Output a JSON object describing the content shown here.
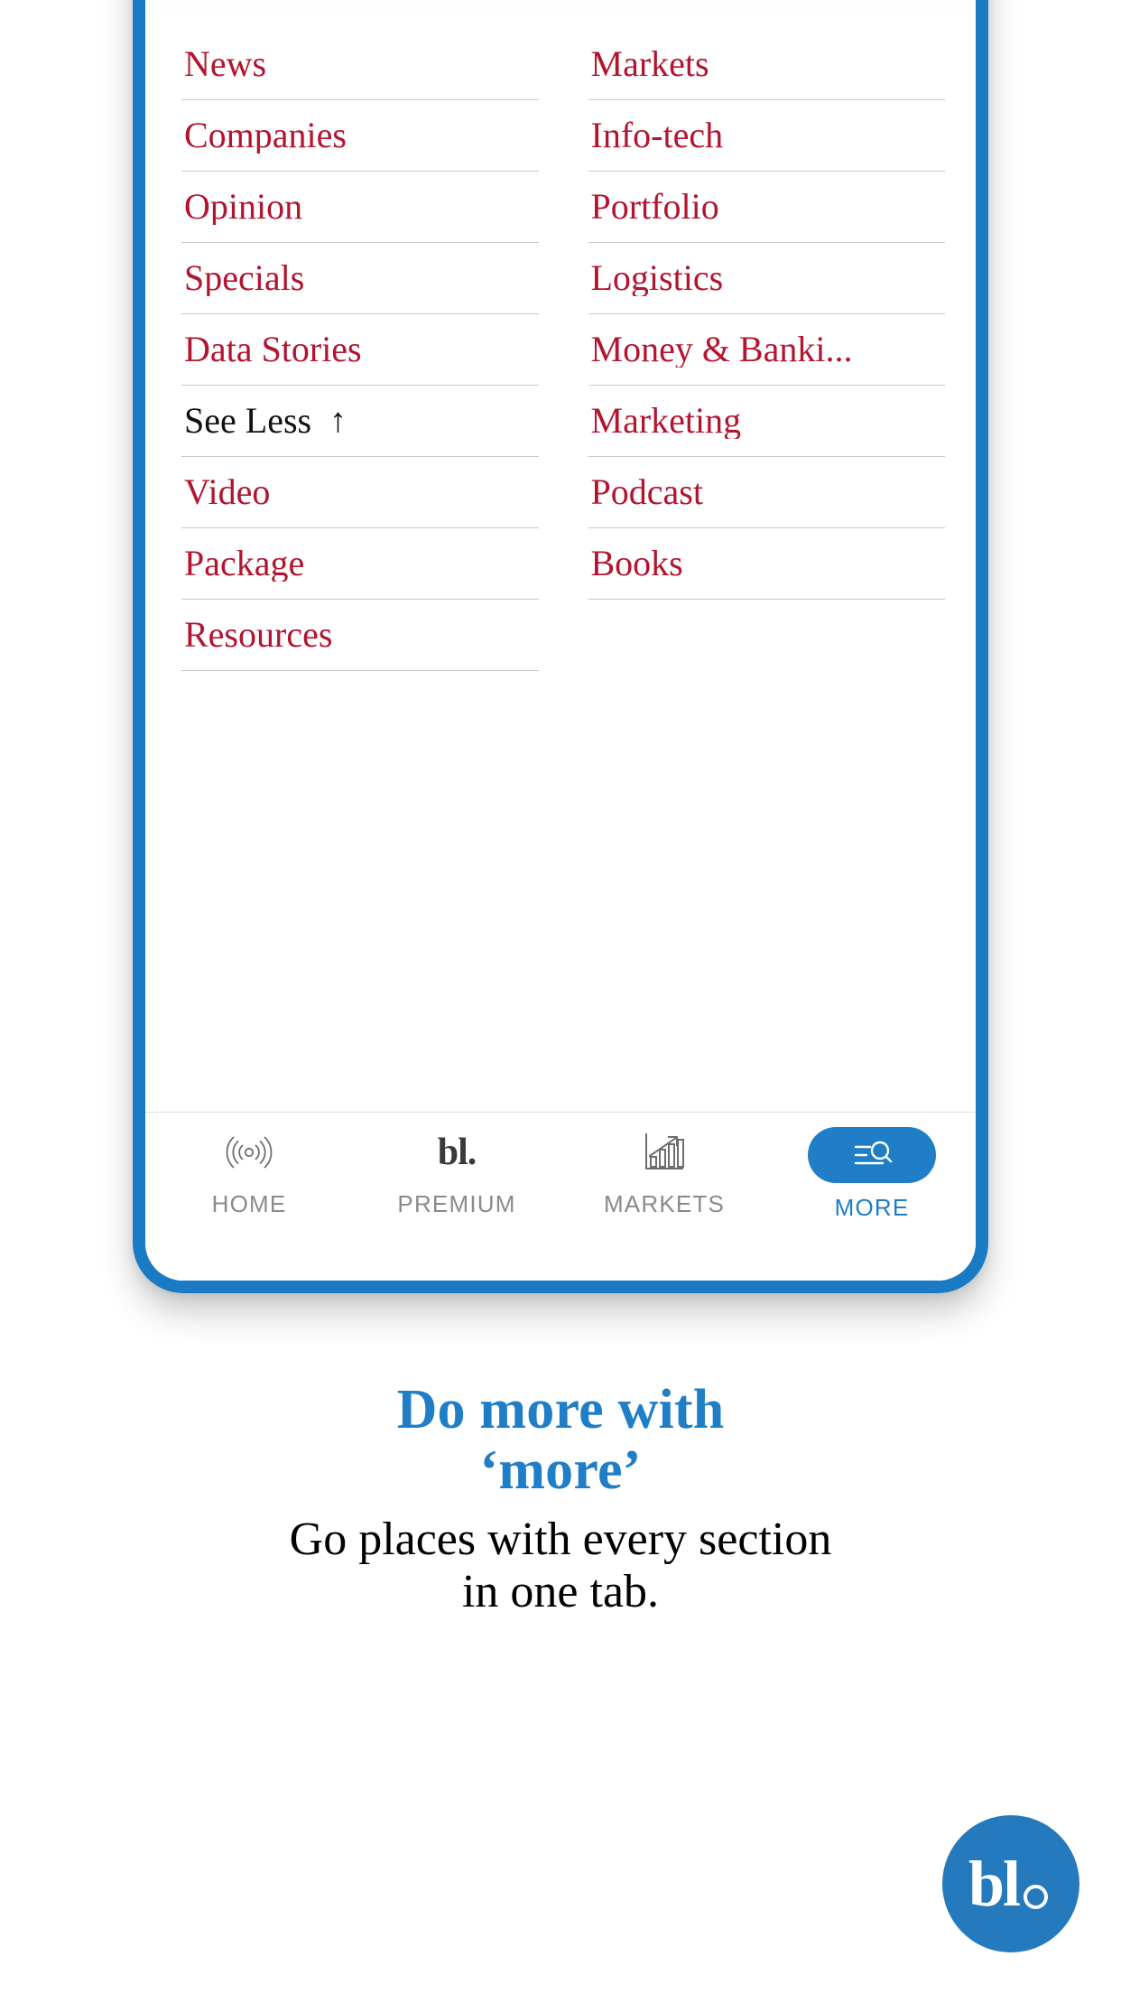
{
  "device": {
    "frame_color": "#1a7ac4"
  },
  "menu": {
    "left_column": [
      {
        "label": "News",
        "style": "link"
      },
      {
        "label": "Companies",
        "style": "link"
      },
      {
        "label": "Opinion",
        "style": "link"
      },
      {
        "label": "Specials",
        "style": "link"
      },
      {
        "label": "Data Stories",
        "style": "link"
      },
      {
        "label": "See Less",
        "style": "toggle",
        "arrow": "↑"
      },
      {
        "label": "Video",
        "style": "link"
      },
      {
        "label": "Package",
        "style": "link"
      },
      {
        "label": "Resources",
        "style": "link"
      }
    ],
    "right_column": [
      {
        "label": "Markets",
        "style": "link"
      },
      {
        "label": "Info-tech",
        "style": "link"
      },
      {
        "label": "Portfolio",
        "style": "link"
      },
      {
        "label": "Logistics",
        "style": "link"
      },
      {
        "label": "Money & Banki...",
        "style": "link"
      },
      {
        "label": "Marketing",
        "style": "link"
      },
      {
        "label": "Podcast",
        "style": "link"
      },
      {
        "label": "Books",
        "style": "link"
      }
    ],
    "link_color": "#b3142f",
    "toggle_color": "#111111"
  },
  "tabbar": {
    "tabs": [
      {
        "label": "HOME",
        "icon": "broadcast-icon",
        "active": false
      },
      {
        "label": "PREMIUM",
        "icon": "bl-wordmark-icon",
        "wordmark": "bl.",
        "active": false
      },
      {
        "label": "MARKETS",
        "icon": "bar-chart-arrow-icon",
        "active": false
      },
      {
        "label": "MORE",
        "icon": "menu-search-icon",
        "active": true
      }
    ],
    "inactive_color": "#8a8a8a",
    "active_color": "#1f7ec6"
  },
  "promo": {
    "heading_line1": "Do more with",
    "heading_line2": "‘more’",
    "subtitle_line1": "Go places with every section",
    "subtitle_line2": "in one tab.",
    "heading_color": "#1f7ec6",
    "subtitle_color": "#000000"
  },
  "logo": {
    "text": "bl",
    "background_color": "#2579bd"
  }
}
